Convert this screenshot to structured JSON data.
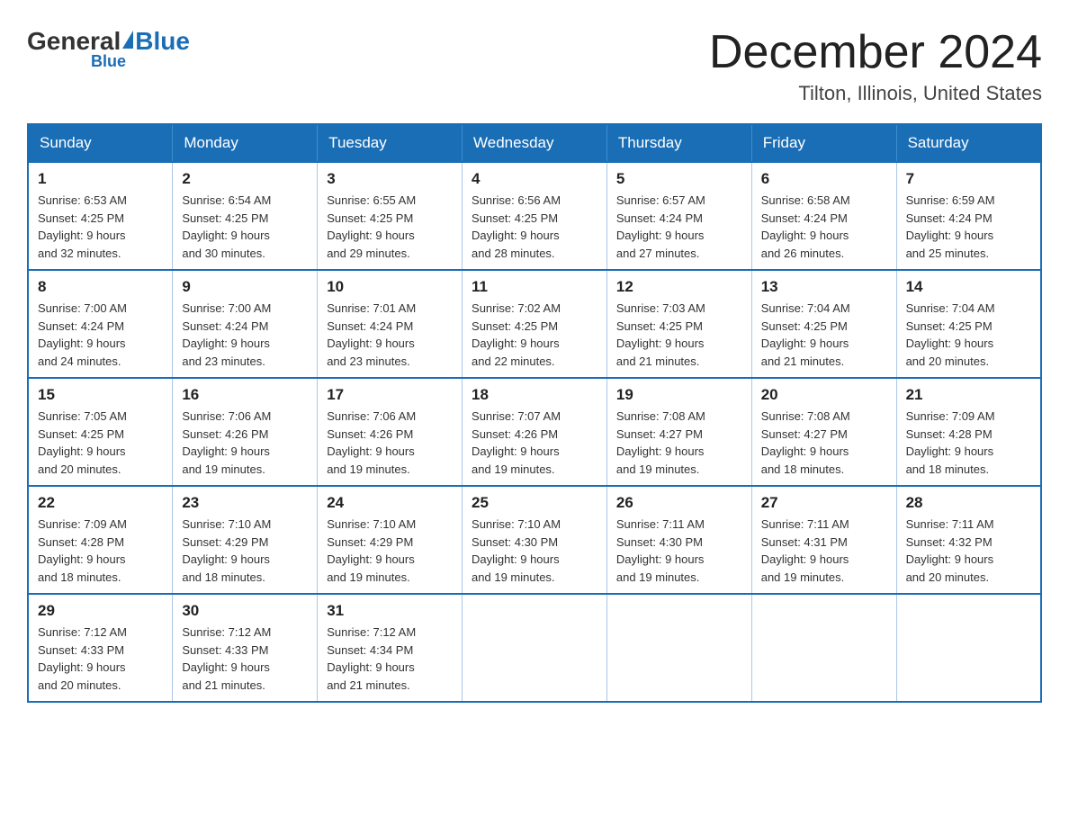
{
  "logo": {
    "general": "General",
    "blue": "Blue"
  },
  "header": {
    "month": "December 2024",
    "location": "Tilton, Illinois, United States"
  },
  "weekdays": [
    "Sunday",
    "Monday",
    "Tuesday",
    "Wednesday",
    "Thursday",
    "Friday",
    "Saturday"
  ],
  "weeks": [
    [
      {
        "day": "1",
        "sunrise": "6:53 AM",
        "sunset": "4:25 PM",
        "daylight": "9 hours and 32 minutes."
      },
      {
        "day": "2",
        "sunrise": "6:54 AM",
        "sunset": "4:25 PM",
        "daylight": "9 hours and 30 minutes."
      },
      {
        "day": "3",
        "sunrise": "6:55 AM",
        "sunset": "4:25 PM",
        "daylight": "9 hours and 29 minutes."
      },
      {
        "day": "4",
        "sunrise": "6:56 AM",
        "sunset": "4:25 PM",
        "daylight": "9 hours and 28 minutes."
      },
      {
        "day": "5",
        "sunrise": "6:57 AM",
        "sunset": "4:24 PM",
        "daylight": "9 hours and 27 minutes."
      },
      {
        "day": "6",
        "sunrise": "6:58 AM",
        "sunset": "4:24 PM",
        "daylight": "9 hours and 26 minutes."
      },
      {
        "day": "7",
        "sunrise": "6:59 AM",
        "sunset": "4:24 PM",
        "daylight": "9 hours and 25 minutes."
      }
    ],
    [
      {
        "day": "8",
        "sunrise": "7:00 AM",
        "sunset": "4:24 PM",
        "daylight": "9 hours and 24 minutes."
      },
      {
        "day": "9",
        "sunrise": "7:00 AM",
        "sunset": "4:24 PM",
        "daylight": "9 hours and 23 minutes."
      },
      {
        "day": "10",
        "sunrise": "7:01 AM",
        "sunset": "4:24 PM",
        "daylight": "9 hours and 23 minutes."
      },
      {
        "day": "11",
        "sunrise": "7:02 AM",
        "sunset": "4:25 PM",
        "daylight": "9 hours and 22 minutes."
      },
      {
        "day": "12",
        "sunrise": "7:03 AM",
        "sunset": "4:25 PM",
        "daylight": "9 hours and 21 minutes."
      },
      {
        "day": "13",
        "sunrise": "7:04 AM",
        "sunset": "4:25 PM",
        "daylight": "9 hours and 21 minutes."
      },
      {
        "day": "14",
        "sunrise": "7:04 AM",
        "sunset": "4:25 PM",
        "daylight": "9 hours and 20 minutes."
      }
    ],
    [
      {
        "day": "15",
        "sunrise": "7:05 AM",
        "sunset": "4:25 PM",
        "daylight": "9 hours and 20 minutes."
      },
      {
        "day": "16",
        "sunrise": "7:06 AM",
        "sunset": "4:26 PM",
        "daylight": "9 hours and 19 minutes."
      },
      {
        "day": "17",
        "sunrise": "7:06 AM",
        "sunset": "4:26 PM",
        "daylight": "9 hours and 19 minutes."
      },
      {
        "day": "18",
        "sunrise": "7:07 AM",
        "sunset": "4:26 PM",
        "daylight": "9 hours and 19 minutes."
      },
      {
        "day": "19",
        "sunrise": "7:08 AM",
        "sunset": "4:27 PM",
        "daylight": "9 hours and 19 minutes."
      },
      {
        "day": "20",
        "sunrise": "7:08 AM",
        "sunset": "4:27 PM",
        "daylight": "9 hours and 18 minutes."
      },
      {
        "day": "21",
        "sunrise": "7:09 AM",
        "sunset": "4:28 PM",
        "daylight": "9 hours and 18 minutes."
      }
    ],
    [
      {
        "day": "22",
        "sunrise": "7:09 AM",
        "sunset": "4:28 PM",
        "daylight": "9 hours and 18 minutes."
      },
      {
        "day": "23",
        "sunrise": "7:10 AM",
        "sunset": "4:29 PM",
        "daylight": "9 hours and 18 minutes."
      },
      {
        "day": "24",
        "sunrise": "7:10 AM",
        "sunset": "4:29 PM",
        "daylight": "9 hours and 19 minutes."
      },
      {
        "day": "25",
        "sunrise": "7:10 AM",
        "sunset": "4:30 PM",
        "daylight": "9 hours and 19 minutes."
      },
      {
        "day": "26",
        "sunrise": "7:11 AM",
        "sunset": "4:30 PM",
        "daylight": "9 hours and 19 minutes."
      },
      {
        "day": "27",
        "sunrise": "7:11 AM",
        "sunset": "4:31 PM",
        "daylight": "9 hours and 19 minutes."
      },
      {
        "day": "28",
        "sunrise": "7:11 AM",
        "sunset": "4:32 PM",
        "daylight": "9 hours and 20 minutes."
      }
    ],
    [
      {
        "day": "29",
        "sunrise": "7:12 AM",
        "sunset": "4:33 PM",
        "daylight": "9 hours and 20 minutes."
      },
      {
        "day": "30",
        "sunrise": "7:12 AM",
        "sunset": "4:33 PM",
        "daylight": "9 hours and 21 minutes."
      },
      {
        "day": "31",
        "sunrise": "7:12 AM",
        "sunset": "4:34 PM",
        "daylight": "9 hours and 21 minutes."
      },
      null,
      null,
      null,
      null
    ]
  ],
  "labels": {
    "sunrise": "Sunrise:",
    "sunset": "Sunset:",
    "daylight": "Daylight:"
  }
}
